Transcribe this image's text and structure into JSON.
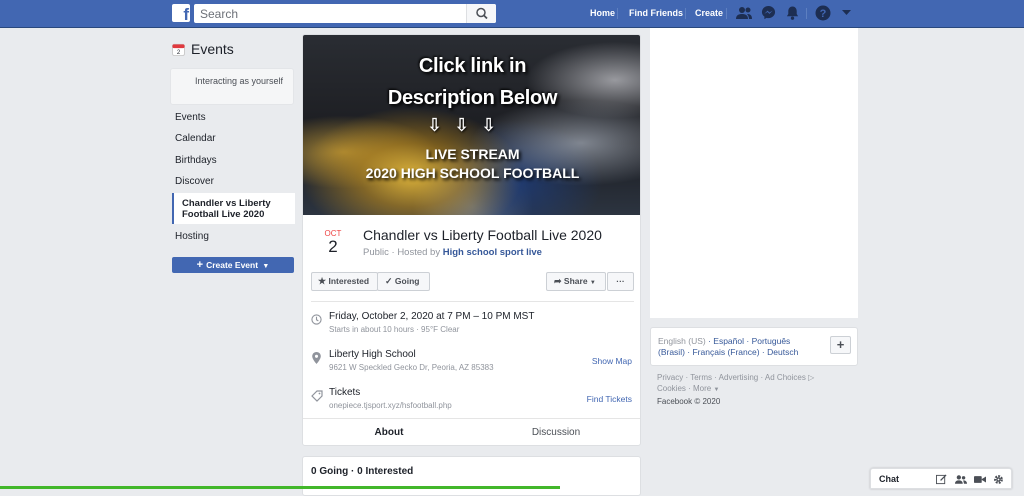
{
  "topbar": {
    "search_placeholder": "Search",
    "nav": {
      "home": "Home",
      "find_friends": "Find Friends",
      "create": "Create"
    }
  },
  "sidebar": {
    "title": "Events",
    "interacting": "Interacting as yourself",
    "items": [
      "Events",
      "Calendar",
      "Birthdays",
      "Discover"
    ],
    "active_item": "Chandler vs Liberty Football Live 2020",
    "hosting": "Hosting",
    "create_event": "Create Event"
  },
  "cover": {
    "line1": "Click link in",
    "line2": "Description Below",
    "arrows": "⇩⇩⇩",
    "line3": "LIVE STREAM",
    "line4": "2020 HIGH SCHOOL FOOTBALL"
  },
  "event": {
    "month": "OCT",
    "day": "2",
    "title": "Chandler vs Liberty Football Live 2020",
    "sub_prefix": "Public · Hosted by",
    "host": "High school sport live",
    "buttons": {
      "interested": "Interested",
      "going": "Going",
      "share": "Share",
      "more": "···"
    },
    "datetime": "Friday, October 2, 2020 at 7 PM – 10 PM MST",
    "datetime_sub": "Starts in about 10 hours · 95°F Clear",
    "location": "Liberty High School",
    "address": "9621 W Speckled Gecko Dr, Peoria, AZ 85383",
    "show_map": "Show Map",
    "tickets_label": "Tickets",
    "tickets_url": "onepiece.tjsport.xyz/hsfootball.php",
    "find_tickets": "Find Tickets",
    "tabs": [
      "About",
      "Discussion"
    ],
    "going_summary": "0 Going · 0 Interested"
  },
  "languages": {
    "current": "English (US)",
    "others": [
      "Español",
      "Português (Brasil)",
      "Français (France)",
      "Deutsch"
    ]
  },
  "footer": {
    "links": [
      "Privacy",
      "Terms",
      "Advertising",
      "Ad Choices",
      "Cookies",
      "More"
    ],
    "copyright": "Facebook © 2020"
  },
  "chat": {
    "label": "Chat"
  },
  "colors": {
    "brand": "#4267b2",
    "link": "#365899",
    "date_red": "#e44"
  }
}
